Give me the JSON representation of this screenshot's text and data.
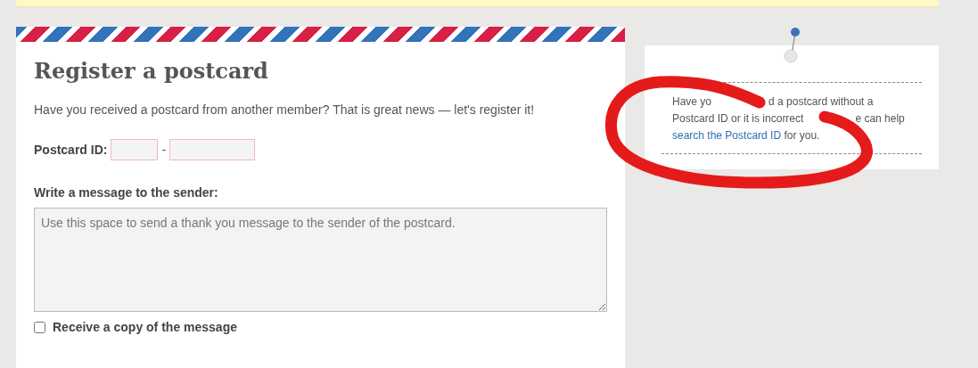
{
  "form": {
    "title": "Register a postcard",
    "intro": "Have you received a postcard from another member? That is great news — let's register it!",
    "id_label": "Postcard ID:",
    "id_separator": "-",
    "message_label": "Write a message to the sender:",
    "message_placeholder": "Use this space to send a thank you message to the sender of the postcard.",
    "copy_checkbox": {
      "label": "Receive a copy of the message",
      "checked": false
    }
  },
  "sidebar": {
    "hint_fragments": [
      "Have yo",
      "d a postcard without a",
      "Postcard ID or it is incorrect",
      "e can help"
    ],
    "link": "search the Postcard ID",
    "hint_end": " for you."
  }
}
